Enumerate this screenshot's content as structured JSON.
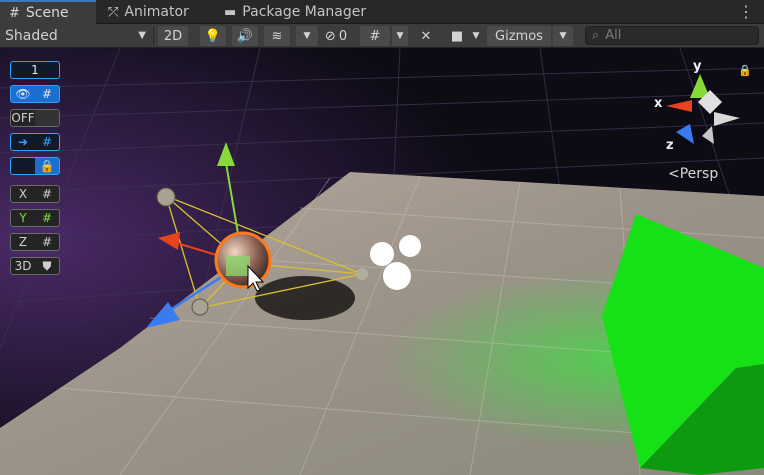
{
  "tabs": [
    {
      "label": "Scene",
      "icon": "grid-icon",
      "active": true
    },
    {
      "label": "Animator",
      "icon": "animator-icon",
      "active": false
    },
    {
      "label": "Package Manager",
      "icon": "package-icon",
      "active": false
    }
  ],
  "toolbar": {
    "draw_mode": "Shaded",
    "two_d": "2D",
    "hidden_count": "0",
    "gizmos": "Gizmos",
    "search_placeholder": "All"
  },
  "overlay": {
    "field_value": "1",
    "off_label": "OFF",
    "x_label": "X",
    "y_label": "Y",
    "z_label": "Z",
    "three_d_label": "3D"
  },
  "gizmo": {
    "x": "x",
    "y": "y",
    "z": "z",
    "projection": "Persp"
  },
  "colors": {
    "accent": "#3a79bb",
    "toggle_blue": "#2fa2ff",
    "axis_x": "#e8421e",
    "axis_y": "#87d93a",
    "axis_z": "#3a7bf0",
    "cube_green": "#16e016"
  }
}
